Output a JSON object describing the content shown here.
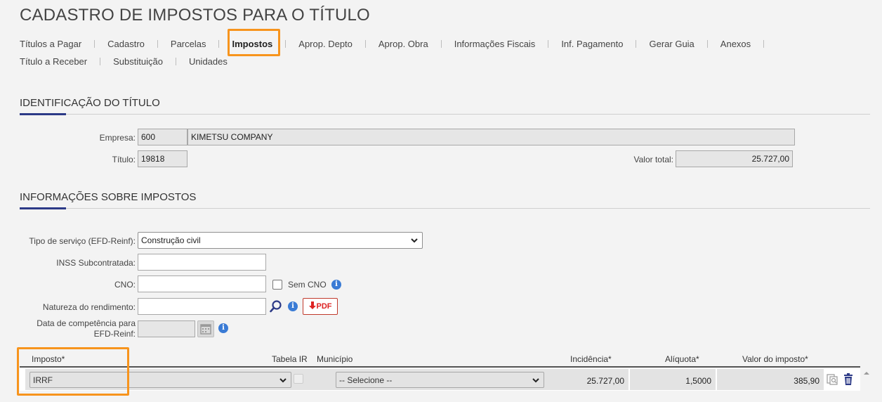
{
  "page_title": "CADASTRO DE IMPOSTOS PARA O TÍTULO",
  "tabs": {
    "row1": [
      "Títulos a Pagar",
      "Cadastro",
      "Parcelas",
      "Impostos",
      "Aprop. Depto",
      "Aprop. Obra",
      "Informações Fiscais",
      "Inf. Pagamento",
      "Gerar Guia",
      "Anexos"
    ],
    "row2": [
      "Título a Receber",
      "Substituição",
      "Unidades"
    ],
    "active": "Impostos"
  },
  "identificacao": {
    "title": "IDENTIFICAÇÃO DO TÍTULO",
    "empresa_label": "Empresa:",
    "empresa_code": "600",
    "empresa_name": "KIMETSU COMPANY",
    "titulo_label": "Título:",
    "titulo_value": "19818",
    "valor_total_label": "Valor total:",
    "valor_total_value": "25.727,00"
  },
  "impostos_info": {
    "title": "INFORMAÇÕES SOBRE IMPOSTOS",
    "tipo_servico_label": "Tipo de serviço (EFD-Reinf):",
    "tipo_servico_value": "Construção civil",
    "inss_label": "INSS Subcontratada:",
    "inss_value": "",
    "cno_label": "CNO:",
    "cno_value": "",
    "sem_cno_label": "Sem CNO",
    "natureza_label": "Natureza do rendimento:",
    "natureza_value": "",
    "pdf_label": "PDF",
    "data_comp_label_1": "Data de competência para",
    "data_comp_label_2": "EFD-Reinf:",
    "data_comp_value": ""
  },
  "grid": {
    "headers": {
      "imposto": "Imposto*",
      "tabela_ir": "Tabela IR",
      "municipio": "Município",
      "incidencia": "Incidência*",
      "aliquota": "Alíquota*",
      "valor_imposto": "Valor do imposto*"
    },
    "row": {
      "imposto": "IRRF",
      "municipio": "-- Selecione --",
      "incidencia": "25.727,00",
      "aliquota": "1,5000",
      "valor_imposto": "385,90"
    }
  },
  "colors": {
    "highlight": "#f7941d",
    "accent": "#2c3a87",
    "info": "#3a7bd5",
    "pdf": "#d22222"
  },
  "icons": [
    "chevron-down-icon",
    "search-icon",
    "info-icon",
    "pdf-download-icon",
    "calendar-icon",
    "copy-icon",
    "trash-icon"
  ]
}
